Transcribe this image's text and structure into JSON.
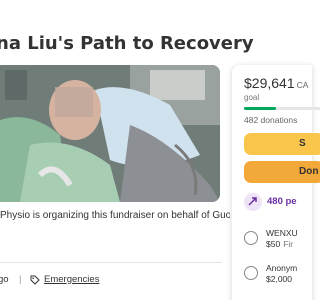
{
  "title": "na Liu's Path to Recovery",
  "organizer_line": "Physio is organizing this fundraiser on behalf of Guoxiang Yin.",
  "meta": {
    "ago": "go",
    "separator": "|",
    "category": "Emergencies"
  },
  "sidebar": {
    "amount": "$29,641",
    "currency": "CA",
    "goal_label": "goal",
    "progress_fraction": 0.4,
    "donations": "482 donations",
    "share_label": "S",
    "donate_label": "Don",
    "people_text": "480 pe",
    "donors": [
      {
        "name": "WENXU",
        "amount": "$50",
        "type": "Fir"
      },
      {
        "name": "Anonym",
        "amount": "$2,000",
        "type": ""
      }
    ]
  },
  "colors": {
    "progress": "#02a95c",
    "share_button": "#f9c54a",
    "donate_button": "#f3a83a",
    "people_accent": "#6b2fa3"
  }
}
